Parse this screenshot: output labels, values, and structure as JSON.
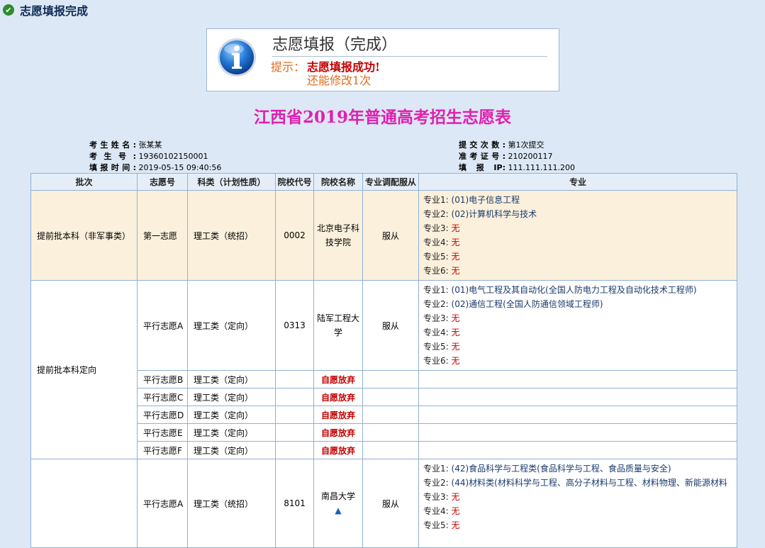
{
  "header": {
    "title": "志愿填报完成"
  },
  "notice": {
    "title": "志愿填报（完成）",
    "label": "提示：",
    "message": "志愿填报成功!",
    "sub": "还能修改1次"
  },
  "heading": "江西省2019年普通高考招生志愿表",
  "candidate": {
    "name_label": "考生姓名:",
    "name": "张某某",
    "id_label": "考生号:",
    "id": "19360102150001",
    "time_label": "填报时间:",
    "time": "2019-05-15 09:40:56",
    "count_label": "提交次数:",
    "count": "第1次提交",
    "ticket_label": "准考证号:",
    "ticket": "210200117",
    "ip_label": "填报IP:",
    "ip": "111.111.111.200"
  },
  "table": {
    "headers": [
      "批次",
      "志愿号",
      "科类（计划性质）",
      "院校代号",
      "院校名称",
      "专业调配服从",
      "专业"
    ],
    "groups": [
      {
        "batch": "提前批本科（非军事类）",
        "rows": [
          {
            "choice": "第一志愿",
            "category": "理工类（统招）",
            "code": "0002",
            "school": "北京电子科技学院",
            "adjust": "服从",
            "majors": [
              {
                "label": "专业1:",
                "value": "(01)电子信息工程"
              },
              {
                "label": "专业2:",
                "value": "(02)计算机科学与技术"
              },
              {
                "label": "专业3:",
                "value": "无"
              },
              {
                "label": "专业4:",
                "value": "无"
              },
              {
                "label": "专业5:",
                "value": "无"
              },
              {
                "label": "专业6:",
                "value": "无"
              }
            ]
          }
        ]
      },
      {
        "batch": "提前批本科定向",
        "rows": [
          {
            "choice": "平行志愿A",
            "category": "理工类（定向）",
            "code": "0313",
            "school": "陆军工程大学",
            "adjust": "服从",
            "majors": [
              {
                "label": "专业1:",
                "value": "(01)电气工程及其自动化(全国人防电力工程及自动化技术工程师)"
              },
              {
                "label": "专业2:",
                "value": "(02)通信工程(全国人防通信领域工程师)"
              },
              {
                "label": "专业3:",
                "value": "无"
              },
              {
                "label": "专业4:",
                "value": "无"
              },
              {
                "label": "专业5:",
                "value": "无"
              },
              {
                "label": "专业6:",
                "value": "无"
              }
            ]
          },
          {
            "choice": "平行志愿B",
            "category": "理工类（定向）",
            "giveup": "自愿放弃"
          },
          {
            "choice": "平行志愿C",
            "category": "理工类（定向）",
            "giveup": "自愿放弃"
          },
          {
            "choice": "平行志愿D",
            "category": "理工类（定向）",
            "giveup": "自愿放弃"
          },
          {
            "choice": "平行志愿E",
            "category": "理工类（定向）",
            "giveup": "自愿放弃"
          },
          {
            "choice": "平行志愿F",
            "category": "理工类（定向）",
            "giveup": "自愿放弃"
          }
        ]
      },
      {
        "batch": "",
        "rows": [
          {
            "choice": "平行志愿A",
            "category": "理工类（统招）",
            "code": "8101",
            "school": "南昌大学",
            "school_mark": "▲",
            "adjust": "服从",
            "majors": [
              {
                "label": "专业1:",
                "value": "(42)食品科学与工程类(食品科学与工程、食品质量与安全)"
              },
              {
                "label": "专业2:",
                "value": "(44)材料类(材料科学与工程、高分子材料与工程、材料物理、新能源材料"
              },
              {
                "label": "专业3:",
                "value": "无"
              },
              {
                "label": "专业4:",
                "value": "无"
              },
              {
                "label": "专业5:",
                "value": "无"
              }
            ]
          }
        ]
      }
    ]
  }
}
